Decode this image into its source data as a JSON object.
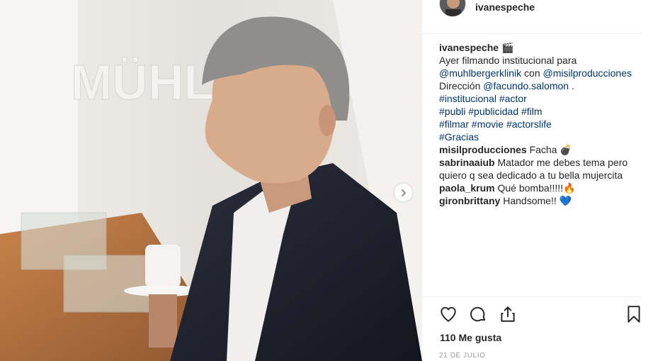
{
  "post": {
    "author": "ivanespeche",
    "caption": {
      "user": "ivanespeche",
      "emoji": "🎬",
      "line1": "Ayer filmando institucional para",
      "mention1": "@muhlbergerklinik",
      "con": "con",
      "mention2": "@misilproducciones",
      "direccion": "Dirección",
      "mention3": "@facundo.salomon",
      "dot": ".",
      "tags_line1": [
        "#institucional",
        "#actor"
      ],
      "tags_line2": [
        "#publi",
        "#publicidad",
        "#film"
      ],
      "tags_line3": [
        "#filmar",
        "#movie",
        "#actorslife"
      ],
      "tags_line4": [
        "#Gracias"
      ]
    },
    "comments": [
      {
        "user": "misilproducciones",
        "text": "Facha 💣"
      },
      {
        "user": "sabrinaaiub",
        "text": "Matador me debes tema pero quiero q sea dedicado a tu bella mujercita"
      },
      {
        "user": "paola_krum",
        "text": "Qué bomba!!!!!🔥"
      },
      {
        "user": "gironbrittany",
        "text": "Handsome!! 💙"
      }
    ],
    "likes": "110 Me gusta",
    "date": "21 DE JULIO",
    "media": {
      "wall_sign": "MÜHLBERGER"
    }
  },
  "icons": {
    "like": "heart-icon",
    "comment": "comment-icon",
    "share": "share-icon",
    "save": "bookmark-icon",
    "next": "chevron-right-icon"
  },
  "colors": {
    "link": "#003569",
    "text": "#262626",
    "muted": "#999999"
  }
}
